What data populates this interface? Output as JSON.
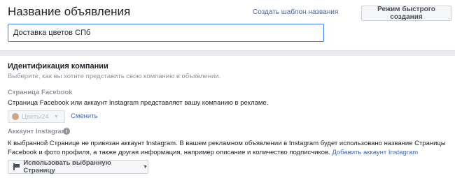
{
  "header": {
    "title": "Название объявления",
    "template_link": "Создать шаблон названия",
    "quick_mode_button": "Режим быстрого создания",
    "ad_name_value": "Доставка цветов СПб"
  },
  "identity": {
    "title": "Идентификация компании",
    "description": "Выберите, как вы хотите представить свою компанию в объявлении.",
    "facebook_page": {
      "label": "Страница Facebook",
      "description": "Страница Facebook или аккаунт Instagram представляет вашу компанию в рекламе.",
      "selected_page": "Цветы24",
      "change_link": "Сменить"
    },
    "instagram": {
      "label": "Аккаунт Instagram",
      "info_icon": "i",
      "description": "К выбранной Странице не привязан аккаунт Instagram. В вашем рекламном объявлении в Instagram будет использовано название Страницы Facebook и фото профиля, а также другая информация, например описание и количество подписчиков.",
      "add_link": "Добавить аккаунт Instagram",
      "use_page_button": "Использовать выбранную Страницу"
    }
  },
  "icons": {
    "info": "info-icon",
    "flag": "flag-icon",
    "caret": "chevron-down-icon",
    "page_avatar": "page-avatar"
  },
  "colors": {
    "link": "#4267b2",
    "input_focus": "#4080ff",
    "section_divider": "#e9ebee"
  }
}
